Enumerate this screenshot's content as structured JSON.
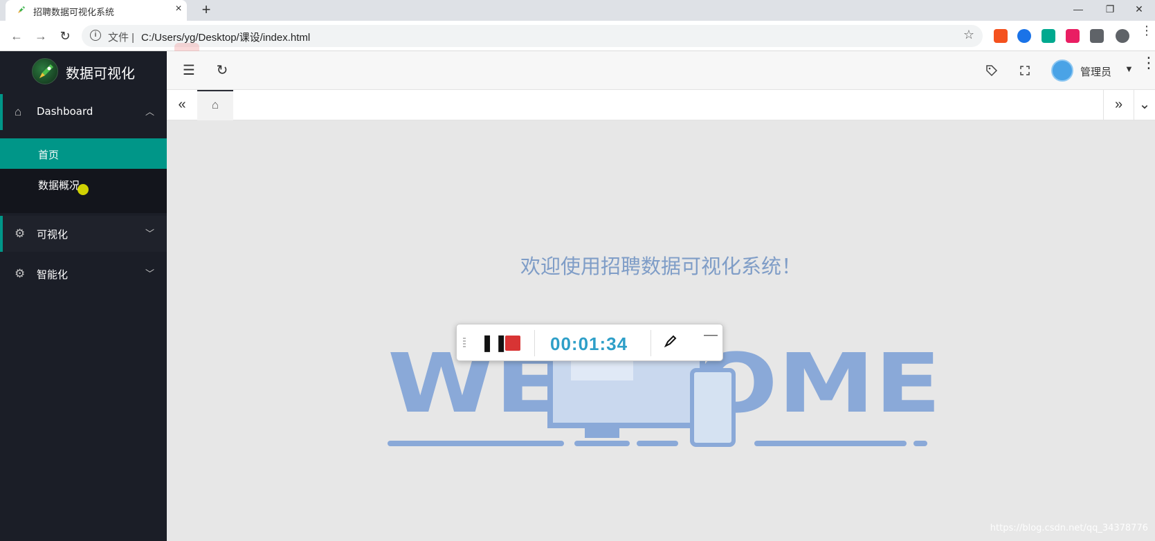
{
  "browser": {
    "tab_title": "招聘数据可视化系统",
    "tab_close": "×",
    "new_tab": "+",
    "window_controls": [
      "—",
      "❐",
      "✕"
    ],
    "address_prefix": "文件",
    "address_url": "C:/Users/yg/Desktop/课设/index.html",
    "nav_back": "←",
    "nav_forward": "→",
    "nav_reload": "↻",
    "star": "☆",
    "menu": "⋮",
    "extensions": [
      {
        "name": "speaker-extension-icon",
        "color": "#f4511e"
      },
      {
        "name": "asterisk-extension-icon",
        "color": "#1a73e8"
      },
      {
        "name": "n-extension-icon",
        "color": "#00a98f"
      },
      {
        "name": "colorful-extension-icon",
        "color": "#e91e63"
      },
      {
        "name": "puzzle-extension-icon",
        "color": "#5f6368"
      }
    ]
  },
  "sidebar": {
    "app_name": "数据可视化",
    "menu": [
      {
        "label": "Dashboard",
        "icon": "home-icon",
        "expanded": true
      },
      {
        "label": "可视化",
        "icon": "gear-icon",
        "expanded": false
      },
      {
        "label": "智能化",
        "icon": "gear-icon",
        "expanded": false
      }
    ],
    "submenu": [
      {
        "label": "首页",
        "active": true
      },
      {
        "label": "数据概况",
        "active": false
      }
    ],
    "accent_color": "#009688"
  },
  "header": {
    "user_name": "管理员",
    "menu_toggle": "☰",
    "refresh": "↻",
    "tag_icon": "tag-icon",
    "fullscreen_icon": "fullscreen-icon"
  },
  "tabstrip": {
    "prev": "«",
    "next": "»",
    "dropdown": "⌄",
    "home": "⌂"
  },
  "main": {
    "welcome_text": "欢迎使用招聘数据可视化系统！",
    "welcome_graphic_text": "WELCOME",
    "graphic_color": "#8aa9d8"
  },
  "recorder": {
    "time": "00:01:34",
    "pause": "❚❚",
    "minimize": "—",
    "stop_color": "#d83434"
  },
  "watermark": "https://blog.csdn.net/qq_34378776"
}
